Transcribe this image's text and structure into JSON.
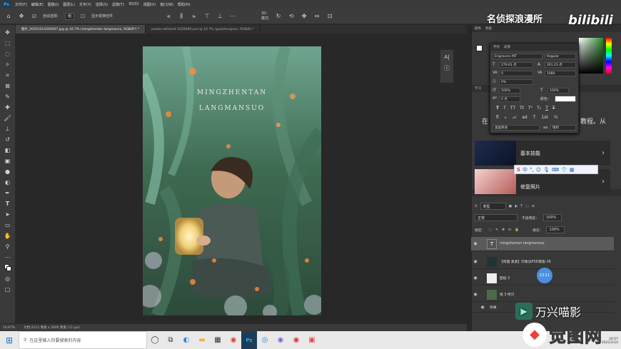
{
  "app": {
    "logo": "Ps"
  },
  "menu": [
    "文件(F)",
    "编辑(E)",
    "图像(I)",
    "图层(L)",
    "文字(Y)",
    "选择(S)",
    "滤镜(T)",
    "3D(D)",
    "视图(V)",
    "窗口(W)",
    "帮助(H)"
  ],
  "options_bar": {
    "auto_select_label": "自动选择：",
    "auto_select_value": "组",
    "show_transform_label": "显示变换控件"
  },
  "tabs": [
    {
      "label": "图片_20201214200407.jpg @ 16.7% (mingzhentan langmansu, RGB/8*) *"
    },
    {
      "label": "pexels-william4 2028980.psd @ 16.7% (guazhengnan, RGB/8) *"
    }
  ],
  "photo": {
    "line1": "MINGZHENTAN",
    "line2": "LANGMANSUO"
  },
  "status_bar": {
    "zoom": "16.67%",
    "doc_size": "文档:2112 像素 x 3000 像素 (72 ppi)"
  },
  "watermark": {
    "channel": "名侦探浪漫所",
    "bilibili": "bilibili",
    "wanxing": "万兴喵影",
    "ditu": "觉图网"
  },
  "right_panel": {
    "top_tabs": [
      "颜色",
      "色板"
    ],
    "char_tabs": [
      "字符",
      "段落"
    ],
    "learn_tabs": [
      "学习"
    ],
    "learn_text": "在",
    "learn_text_right": "教程。从",
    "learn_cards": [
      {
        "title": "基本技能"
      },
      {
        "title": "修复照片"
      }
    ],
    "layer_tabs": [
      "图层",
      "通道",
      "路径"
    ],
    "kind_label": "类型",
    "blend_mode": "正常",
    "opacity_label": "不透明度：",
    "opacity_value": "100%",
    "lock_label": "锁定：",
    "fill_label": "填充：",
    "fill_value": "100%",
    "layers": [
      {
        "name": "mingzhentan langmansuo",
        "thumb": "T"
      },
      {
        "name": "【修图 素素】印象派PSD模板-36",
        "thumb": ""
      },
      {
        "name": "图层 2",
        "thumb": ""
      },
      {
        "name": "组 3 拷贝",
        "thumb": ""
      },
      {
        "name": "效果",
        "thumb": ""
      }
    ],
    "badge": "13:11"
  },
  "character_panel": {
    "font_family": "Engravers MT",
    "font_style": "Regular",
    "size": "279.61 点",
    "leading": "261.23 点",
    "tracking_v": "0",
    "tracking": "1080",
    "scale_v": "0%",
    "vscale": "100%",
    "hscale": "100%",
    "baseline": "0 点",
    "color_label": "颜色：",
    "language": "美国英语",
    "aa": "锐利",
    "aa_prefix": "aa"
  },
  "taskbar": {
    "search_placeholder": "在这里输入你要搜索的内容",
    "clock_time": "20:57",
    "clock_date": "2021/2/14"
  },
  "colors": {
    "accent": "#31a8ff",
    "panel": "#383838",
    "canvas_bg": "#282828"
  }
}
